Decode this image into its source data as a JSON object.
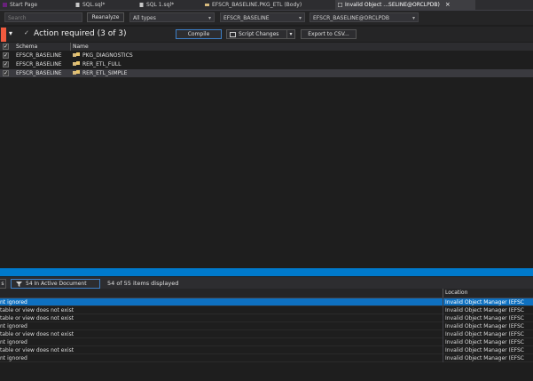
{
  "tabs": [
    {
      "label": "Start Page",
      "icon": "start-page-icon"
    },
    {
      "label": "SQL.sql*",
      "icon": "sql-file-icon"
    },
    {
      "label": "SQL 1.sql*",
      "icon": "sql-file-icon"
    },
    {
      "label": "EFSCR_BASELINE.PKG_ETL (Body)",
      "icon": "package-body-icon"
    },
    {
      "label": "Invalid Object ...SELINE@ORCLPDB)",
      "icon": "invalid-object-icon",
      "close": "×"
    }
  ],
  "toolbar": {
    "search_placeholder": "Search",
    "reanalyze_label": "Reanalyze",
    "type_filter": "All types",
    "schema_filter": "EFSCR_BASELINE",
    "connection_filter": "EFSCR_BASELINE@ORCLPDB"
  },
  "action": {
    "title": "Action required (3 of 3)",
    "compile_label": "Compile",
    "script_label": "Script Changes",
    "export_label": "Export to CSV..."
  },
  "grid": {
    "columns": [
      "Schema",
      "Name"
    ],
    "rows": [
      {
        "schema": "EFSCR_BASELINE",
        "name": "PKG_DIAGNOSTICS",
        "checked": "✓"
      },
      {
        "schema": "EFSCR_BASELINE",
        "name": "RER_ETL_FULL",
        "checked": "✓"
      },
      {
        "schema": "EFSCR_BASELINE",
        "name": "RER_ETL_SIMPLE",
        "checked": "✓"
      }
    ]
  },
  "error_list": {
    "filter_label": "54 In Active Document",
    "count_label": "54 of 55 items displayed",
    "location_header": "Location",
    "rows": [
      {
        "text": "nt ignored",
        "location": "Invalid Object Manager (EFSC"
      },
      {
        "text": "table or view does not exist",
        "location": "Invalid Object Manager (EFSC"
      },
      {
        "text": "table or view does not exist",
        "location": "Invalid Object Manager (EFSC"
      },
      {
        "text": "nt ignored",
        "location": "Invalid Object Manager (EFSC"
      },
      {
        "text": "table or view does not exist",
        "location": "Invalid Object Manager (EFSC"
      },
      {
        "text": "nt ignored",
        "location": "Invalid Object Manager (EFSC"
      },
      {
        "text": "table or view does not exist",
        "location": "Invalid Object Manager (EFSC"
      },
      {
        "text": "nt ignored",
        "location": "Invalid Object Manager (EFSC"
      }
    ]
  },
  "colors": {
    "accent": "#007acc",
    "alert": "#f15a3e",
    "selection": "#0e70c0"
  }
}
